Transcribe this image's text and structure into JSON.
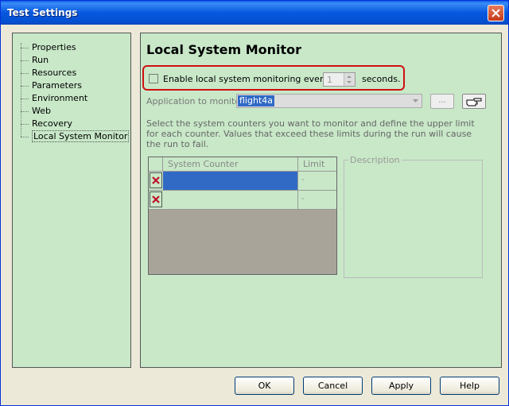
{
  "window": {
    "title": "Test Settings"
  },
  "tree": {
    "items": [
      {
        "label": "Properties"
      },
      {
        "label": "Run"
      },
      {
        "label": "Resources"
      },
      {
        "label": "Parameters"
      },
      {
        "label": "Environment"
      },
      {
        "label": "Web"
      },
      {
        "label": "Recovery"
      },
      {
        "label": "Local System Monitor",
        "selected": true
      }
    ]
  },
  "panel": {
    "title": "Local System Monitor",
    "enable_label": "Enable local system monitoring every:",
    "enable_checked": false,
    "interval_value": "1",
    "seconds_label": "seconds.",
    "app_label": "Application to monitor:",
    "app_value": "flight4a",
    "browse_label": "...",
    "description": "Select the system counters you want to monitor and define the upper limit for each counter. Values that exceed these limits during the run will cause the run to fail.",
    "grid": {
      "col_counter": "System Counter",
      "col_limit": "Limit",
      "rows": [
        {
          "counter": "",
          "limit": "-"
        },
        {
          "counter": "",
          "limit": "-"
        }
      ]
    },
    "description_group": "Description"
  },
  "buttons": {
    "ok": "OK",
    "cancel": "Cancel",
    "apply": "Apply",
    "help": "Help"
  },
  "colors": {
    "title_bar": "#0758e0",
    "panel_bg": "#c8e8c8",
    "highlight": "#d01010",
    "selection": "#316ac5"
  }
}
